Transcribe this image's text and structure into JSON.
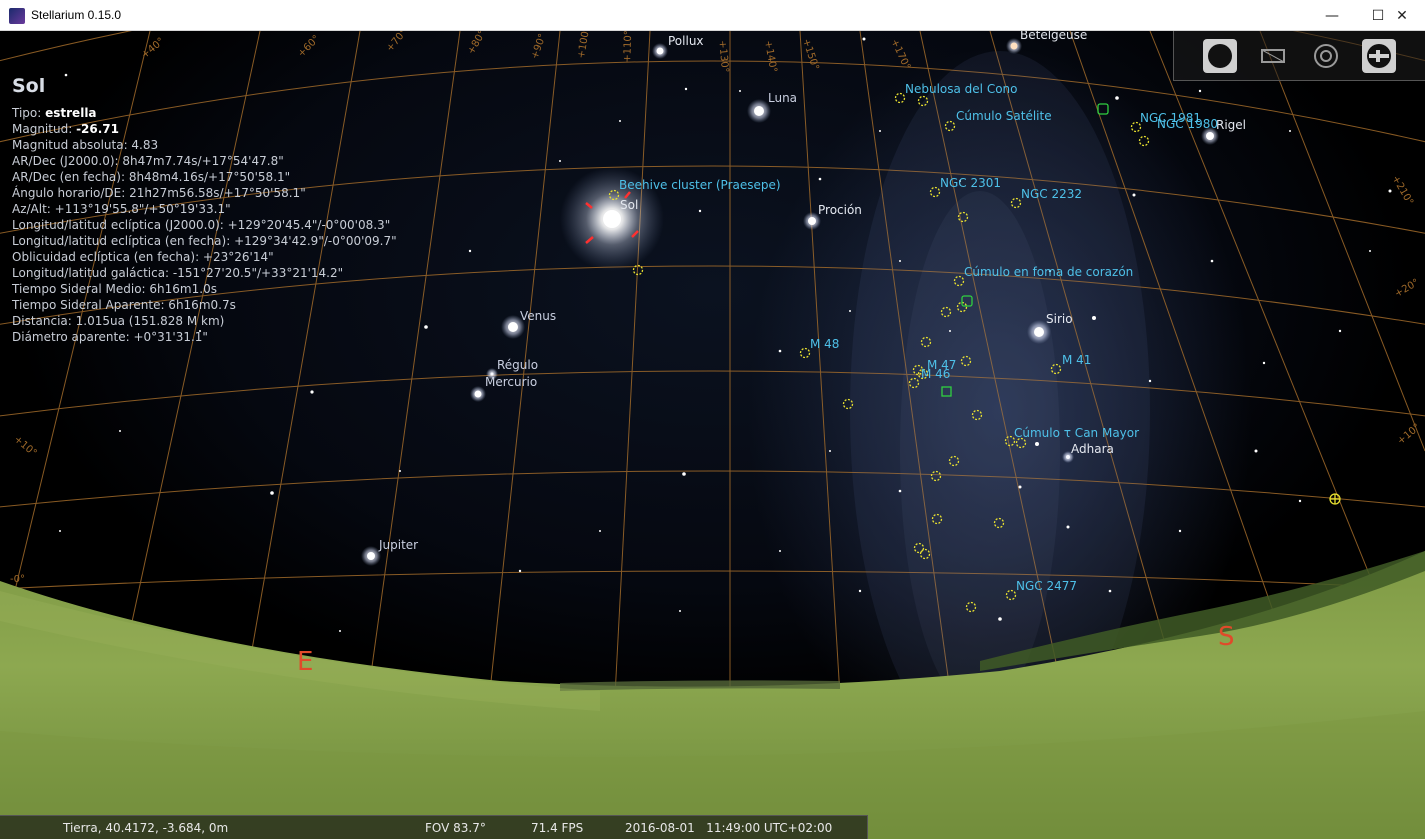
{
  "window": {
    "title": "Stellarium 0.15.0",
    "minimize_glyph": "—",
    "maximize_glyph": "☐",
    "close_glyph": "✕"
  },
  "info_panel": {
    "object_name": "Sol",
    "type_label": "Tipo: ",
    "type_value": "estrella",
    "magnitude_label": "Magnitud: ",
    "magnitude_value": "-26.71",
    "lines": [
      "Magnitud absoluta: 4.83",
      "AR/Dec (J2000.0): 8h47m7.74s/+17°54'47.8\"",
      "AR/Dec (en fecha): 8h48m4.16s/+17°50'58.1\"",
      "Ángulo horario/DE: 21h27m56.58s/+17°50'58.1\"",
      "Az/Alt: +113°19'55.8\"/+50°19'33.1\"",
      "Longitud/latitud eclíptica (J2000.0): +129°20'45.4\"/-0°00'08.3\"",
      "Longitud/latitud eclíptica (en fecha): +129°34'42.9\"/-0°00'09.7\"",
      "Oblicuidad eclíptica (en fecha): +23°26'14\"",
      "Longitud/latitud galáctica: -151°27'20.5\"/+33°21'14.2\"",
      "Tiempo Sideral Medio: 6h16m1.0s",
      "Tiempo Sideral Aparente: 6h16m0.7s",
      "Distancia: 1.015ua (151.828 M km)",
      "Diámetro aparente: +0°31'31.1\""
    ]
  },
  "labels": {
    "stars": [
      "Pollux",
      "Betelgeuse",
      "Rigel",
      "Proción",
      "Sirio",
      "Régulo",
      "Adhara"
    ],
    "planets": [
      "Luna",
      "Sol",
      "Venus",
      "Mercurio",
      "Jupiter"
    ],
    "dso": [
      "Beehive cluster (Praesepe)",
      "Nebulosa del Cono",
      "Cúmulo Satélite",
      "NGC 1981",
      "NGC 1980",
      "NGC 2301",
      "NGC 2232",
      "Cúmulo en foma de corazón",
      "M 48",
      "M 47",
      "M 46",
      "M 41",
      "Cúmulo τ Can Mayor",
      "NGC 2477"
    ]
  },
  "grid_labels": [
    "+40°",
    "+50°",
    "+60°",
    "+70°",
    "+80°",
    "+90°",
    "+100°",
    "+110°",
    "+120°",
    "+130°",
    "+140°",
    "+150°",
    "+160°",
    "+170°",
    "+180°",
    "+190°",
    "+200°",
    "+210°",
    "+20°",
    "+10°",
    "-0°",
    "+30°"
  ],
  "cardinals": {
    "east": "E",
    "south": "S"
  },
  "toolbar": {
    "buttons": [
      "planet-icon",
      "landscape-frame-icon",
      "target-icon",
      "settings-slider-icon"
    ]
  },
  "statusbar": {
    "location": "Tierra, 40.4172, -3.684, 0m",
    "fov": "FOV 83.7°",
    "fps": "71.4 FPS",
    "datetime": "2016-08-01   11:49:00 UTC+02:00"
  },
  "colors": {
    "grid": "#a06a2a",
    "dso": "#4ec0e8",
    "dso_marker": "#e8e030",
    "cardinal": "#e04a2a",
    "ground": "#6f8a3e"
  }
}
